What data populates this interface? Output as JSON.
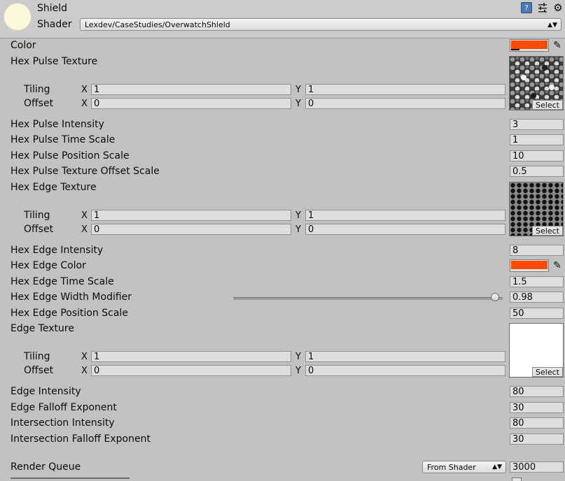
{
  "header": {
    "material_name": "Shield",
    "shader_label": "Shader",
    "shader_value": "Lexdev/CaseStudies/OverwatchShield",
    "help_icon": "book-help-icon",
    "presets_icon": "sliders-icon",
    "settings_icon": "gear-icon"
  },
  "colors": {
    "orange": "#ff4a00",
    "background": "#c2c2c2"
  },
  "properties": {
    "color": {
      "label": "Color",
      "value_color": "#ff4a00"
    },
    "hex_pulse_texture": {
      "label": "Hex Pulse Texture",
      "tiling_label": "Tiling",
      "offset_label": "Offset",
      "tiling_x": "1",
      "tiling_y": "1",
      "offset_x": "0",
      "offset_y": "0",
      "select_label": "Select"
    },
    "hex_pulse_intensity": {
      "label": "Hex Pulse Intensity",
      "value": "3"
    },
    "hex_pulse_time_scale": {
      "label": "Hex Pulse Time Scale",
      "value": "1"
    },
    "hex_pulse_position_scale": {
      "label": "Hex Pulse Position Scale",
      "value": "10"
    },
    "hex_pulse_texture_offset_scale": {
      "label": "Hex Pulse Texture Offset Scale",
      "value": "0.5"
    },
    "hex_edge_texture": {
      "label": "Hex Edge Texture",
      "tiling_label": "Tiling",
      "offset_label": "Offset",
      "tiling_x": "1",
      "tiling_y": "1",
      "offset_x": "0",
      "offset_y": "0",
      "select_label": "Select"
    },
    "hex_edge_intensity": {
      "label": "Hex Edge Intensity",
      "value": "8"
    },
    "hex_edge_color": {
      "label": "Hex Edge Color",
      "value_color": "#ff4a00"
    },
    "hex_edge_time_scale": {
      "label": "Hex Edge Time Scale",
      "value": "1.5"
    },
    "hex_edge_width_modifier": {
      "label": "Hex Edge Width Modifier",
      "value": "0.98",
      "slider_fraction": 0.98
    },
    "hex_edge_position_scale": {
      "label": "Hex Edge Position Scale",
      "value": "50"
    },
    "edge_texture": {
      "label": "Edge Texture",
      "tiling_label": "Tiling",
      "offset_label": "Offset",
      "tiling_x": "1",
      "tiling_y": "1",
      "offset_x": "0",
      "offset_y": "0",
      "select_label": "Select"
    },
    "edge_intensity": {
      "label": "Edge Intensity",
      "value": "80"
    },
    "edge_falloff_exponent": {
      "label": "Edge Falloff Exponent",
      "value": "30"
    },
    "intersection_intensity": {
      "label": "Intersection Intensity",
      "value": "80"
    },
    "intersection_falloff_exponent": {
      "label": "Intersection Falloff Exponent",
      "value": "30"
    }
  },
  "render_queue": {
    "label": "Render Queue",
    "mode": "From Shader",
    "value": "3000"
  },
  "xy": {
    "x": "X",
    "y": "Y"
  }
}
